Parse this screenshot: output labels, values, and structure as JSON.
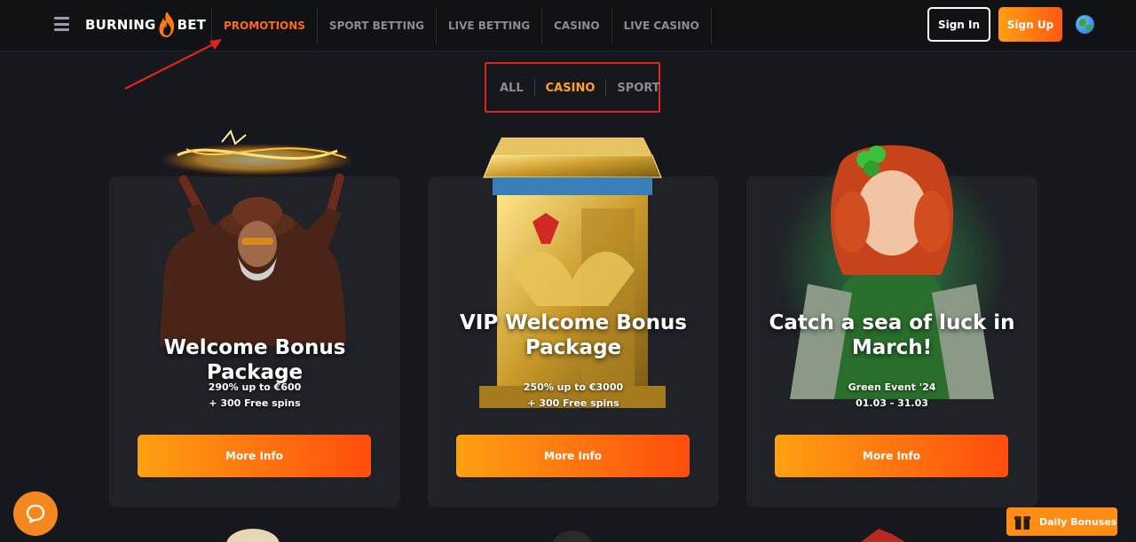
{
  "header": {
    "logo_left": "BURNING",
    "logo_right": "BET",
    "nav": [
      {
        "label": "PROMOTIONS",
        "active": true
      },
      {
        "label": "SPORT BETTING",
        "active": false
      },
      {
        "label": "LIVE BETTING",
        "active": false
      },
      {
        "label": "CASINO",
        "active": false
      },
      {
        "label": "LIVE CASINO",
        "active": false
      }
    ],
    "signin_label": "Sign In",
    "signup_label": "Sign Up",
    "language_icon": "globe-icon"
  },
  "filters": [
    {
      "label": "ALL",
      "active": false
    },
    {
      "label": "CASINO",
      "active": true
    },
    {
      "label": "SPORT",
      "active": false
    }
  ],
  "cards": [
    {
      "title": "Welcome Bonus Package",
      "line1": "290% up to €600",
      "line2": "+ 300 Free spins",
      "button": "More Info"
    },
    {
      "title": "VIP Welcome Bonus Package",
      "line1": "250% up to €3000",
      "line2": "+ 300 Free spins",
      "button": "More Info"
    },
    {
      "title": "Catch a sea of luck in March!",
      "line1": "Green Event '24",
      "line2": "01.03 - 31.03",
      "button": "More Info"
    }
  ],
  "daily_bonuses_label": "Daily Bonuses",
  "colors": {
    "accent": "#ff6a1a",
    "filter_active": "#ffa31a",
    "button_gradient_start": "#ffa012",
    "button_gradient_end": "#ff4d0d",
    "annotation": "#e0241b",
    "background": "#16181d",
    "card": "#202227"
  }
}
